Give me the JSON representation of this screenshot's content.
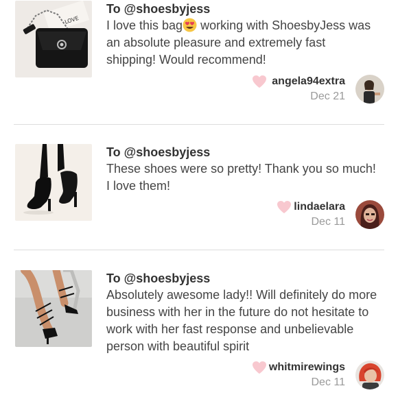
{
  "reviews": [
    {
      "to": "To @shoesbyjess",
      "message_part1": "I love this bag",
      "message_part2": " working with ShoesbyJess was an absolute pleasure and extremely fast shipping! Would recommend!",
      "emoji": "heart-eyes-emoji",
      "author": "angela94extra",
      "date": "Dec 21",
      "thumb_text": "LOVE"
    },
    {
      "to": "To @shoesbyjess",
      "message": "These shoes were so pretty! Thank you so much! I love them!",
      "author": "lindaelara",
      "date": "Dec 11"
    },
    {
      "to": "To @shoesbyjess",
      "message": "Absolutely awesome lady!! Will definitely do more business with her in the future do not hesitate to work with her fast response and unbelievable person with beautiful spirit",
      "author": "whitmirewings",
      "date": "Dec 11"
    }
  ],
  "colors": {
    "heart": "#f8c8cf",
    "divider": "#dddddd",
    "date": "#999999"
  }
}
